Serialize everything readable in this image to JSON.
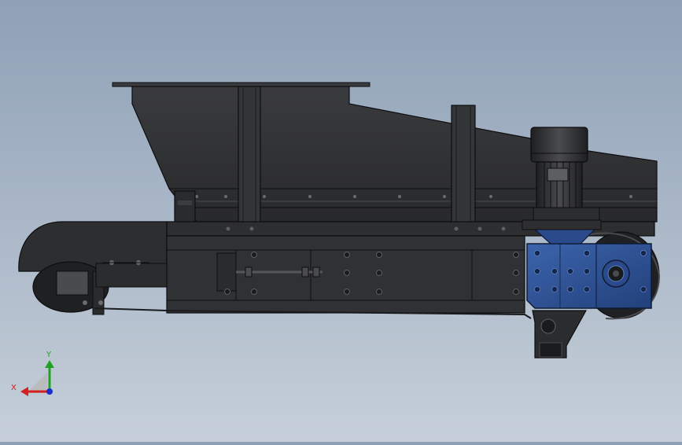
{
  "viewport": {
    "background_top": "#8fa1b6",
    "background_bottom": "#c6cfd9"
  },
  "model": {
    "body_color": "#2e2f31",
    "edge_color": "#0e0e10",
    "highlight_color": "#4a4b4e",
    "gearbox_color": "#2d4f8f",
    "gearbox_highlight": "#4870b8"
  },
  "triad": {
    "x_label": "X",
    "y_label": "Y",
    "x_color": "#d42020",
    "y_color": "#22a022",
    "z_color": "#1a2fc8"
  }
}
